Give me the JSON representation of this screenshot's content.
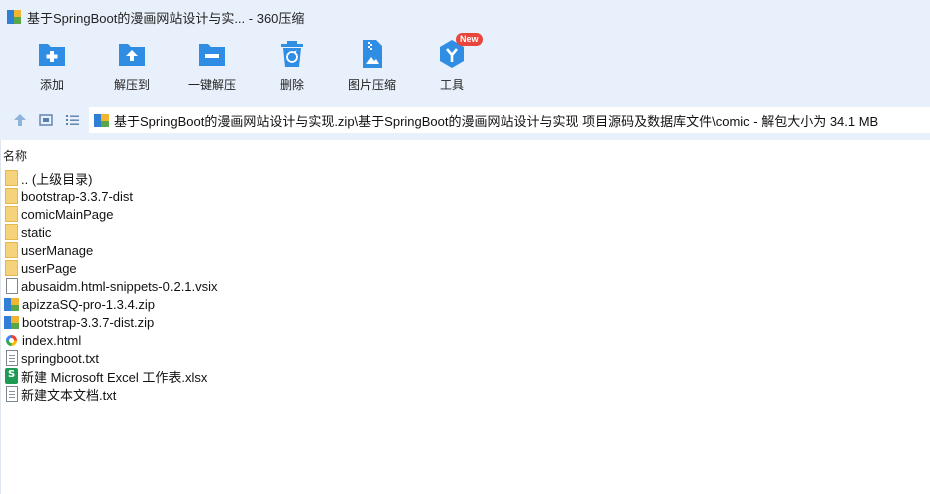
{
  "window": {
    "title": "基于SpringBoot的漫画网站设计与实... - 360压缩"
  },
  "toolbar": {
    "items": [
      {
        "label": "添加",
        "icon": "add-icon"
      },
      {
        "label": "解压到",
        "icon": "extract-to-icon"
      },
      {
        "label": "一键解压",
        "icon": "one-click-extract-icon"
      },
      {
        "label": "删除",
        "icon": "delete-icon"
      },
      {
        "label": "图片压缩",
        "icon": "image-compress-icon"
      },
      {
        "label": "工具",
        "icon": "tools-icon",
        "badge": "New"
      }
    ]
  },
  "address": {
    "path": "基于SpringBoot的漫画网站设计与实现.zip\\基于SpringBoot的漫画网站设计与实现 项目源码及数据库文件\\comic - 解包大小为 34.1 MB"
  },
  "list": {
    "column_name": "名称",
    "files": [
      {
        "name": ".. (上级目录)",
        "type": "folder"
      },
      {
        "name": "bootstrap-3.3.7-dist",
        "type": "folder"
      },
      {
        "name": "comicMainPage",
        "type": "folder"
      },
      {
        "name": "static",
        "type": "folder"
      },
      {
        "name": "userManage",
        "type": "folder"
      },
      {
        "name": "userPage",
        "type": "folder"
      },
      {
        "name": "abusaidm.html-snippets-0.2.1.vsix",
        "type": "file"
      },
      {
        "name": "apizzaSQ-pro-1.3.4.zip",
        "type": "zip"
      },
      {
        "name": "bootstrap-3.3.7-dist.zip",
        "type": "zip"
      },
      {
        "name": "index.html",
        "type": "html"
      },
      {
        "name": "springboot.txt",
        "type": "text"
      },
      {
        "name": "新建 Microsoft Excel 工作表.xlsx",
        "type": "excel"
      },
      {
        "name": "新建文本文档.txt",
        "type": "text"
      }
    ]
  },
  "colors": {
    "chrome_bg": "#e8f1fb",
    "accent_blue": "#2f8de4",
    "badge_red": "#e8453c",
    "folder_yellow": "#f6d37b"
  }
}
